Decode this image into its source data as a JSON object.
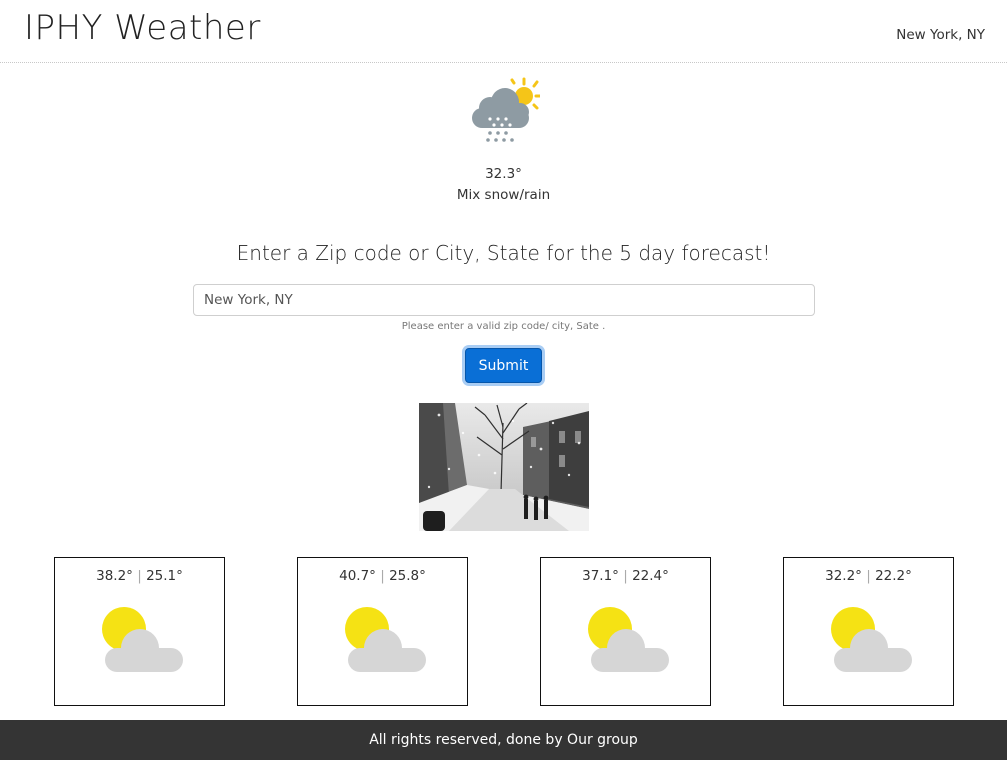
{
  "header": {
    "brand": "IPHY Weather",
    "location": "New York, NY"
  },
  "current": {
    "icon": "snow-rain-sun-icon",
    "temp": "32.3°",
    "condition": "Mix snow/rain"
  },
  "search": {
    "prompt": "Enter a Zip code or City, State for the 5 day forecast!",
    "value": "New York, NY",
    "helper": "Please enter a valid zip code/ city, Sate .",
    "submit_label": "Submit"
  },
  "forecast": [
    {
      "high": "38.2°",
      "separator": "|",
      "low": "25.1°",
      "icon": "partly-cloudy-icon"
    },
    {
      "high": "40.7°",
      "separator": "|",
      "low": "25.8°",
      "icon": "partly-cloudy-icon"
    },
    {
      "high": "37.1°",
      "separator": "|",
      "low": "22.4°",
      "icon": "partly-cloudy-icon"
    },
    {
      "high": "32.2°",
      "separator": "|",
      "low": "22.2°",
      "icon": "partly-cloudy-icon"
    }
  ],
  "footer": {
    "text": "All rights reserved, done by Our group"
  },
  "colors": {
    "accent": "#0a6fd6",
    "footer_bg": "#343434",
    "sun": "#f5e214",
    "cloud": "#d6d6d6"
  }
}
